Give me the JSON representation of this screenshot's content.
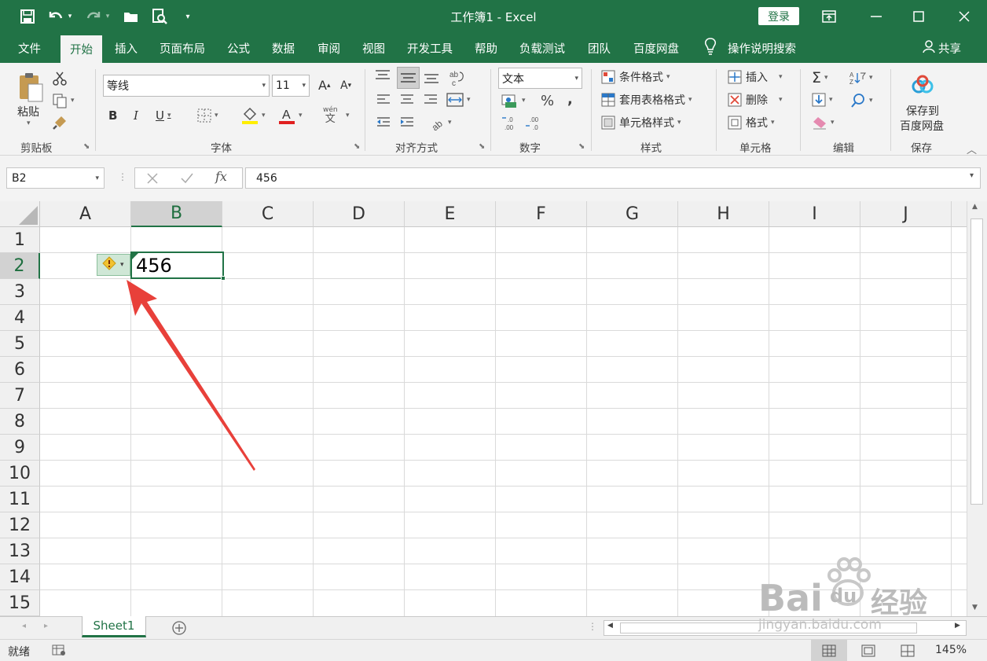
{
  "window": {
    "title": "工作簿1  -  Excel",
    "login": "登录"
  },
  "qat": {
    "save": "save-icon",
    "undo": "undo-icon",
    "redo": "redo-icon",
    "open": "open-icon",
    "preview": "print-preview-icon"
  },
  "menu": {
    "tabs": [
      "文件",
      "开始",
      "插入",
      "页面布局",
      "公式",
      "数据",
      "审阅",
      "视图",
      "开发工具",
      "帮助",
      "负载测试",
      "团队",
      "百度网盘"
    ],
    "active": "开始",
    "search": "操作说明搜索",
    "share": "共享"
  },
  "ribbon": {
    "clipboard": {
      "paste": "粘贴",
      "label": "剪贴板"
    },
    "font": {
      "name": "等线",
      "size": "11",
      "label": "字体",
      "wen": "wén",
      "wen2": "文"
    },
    "alignment": {
      "label": "对齐方式"
    },
    "number": {
      "format": "文本",
      "label": "数字",
      "percent": "%",
      "comma": ","
    },
    "styles": {
      "conditional": "条件格式",
      "table": "套用表格格式",
      "cell": "单元格样式",
      "label": "样式"
    },
    "cells": {
      "insert": "插入",
      "delete": "删除",
      "format": "格式",
      "label": "单元格"
    },
    "editing": {
      "label": "编辑"
    },
    "save": {
      "line1": "保存到",
      "line2": "百度网盘",
      "label": "保存"
    }
  },
  "formula_bar": {
    "name_box": "B2",
    "value": "456",
    "fx": "fx"
  },
  "sheet": {
    "columns": [
      "A",
      "B",
      "C",
      "D",
      "E",
      "F",
      "G",
      "H",
      "I",
      "J"
    ],
    "rows": [
      "1",
      "2",
      "3",
      "4",
      "5",
      "6",
      "7",
      "8",
      "9",
      "10",
      "11",
      "12",
      "13",
      "14",
      "15"
    ],
    "selected_col": "B",
    "selected_row": "2",
    "cell_b2": "456"
  },
  "tabs": {
    "sheet1": "Sheet1"
  },
  "status": {
    "ready": "就绪",
    "zoom": "145%"
  },
  "watermark": {
    "brand": "Bai",
    "brand2": "du",
    "cn": "经验",
    "url": "jingyan.baidu.com"
  },
  "colors": {
    "accent": "#217346",
    "arrow": "#e8403a",
    "warning": "#f2c230"
  }
}
